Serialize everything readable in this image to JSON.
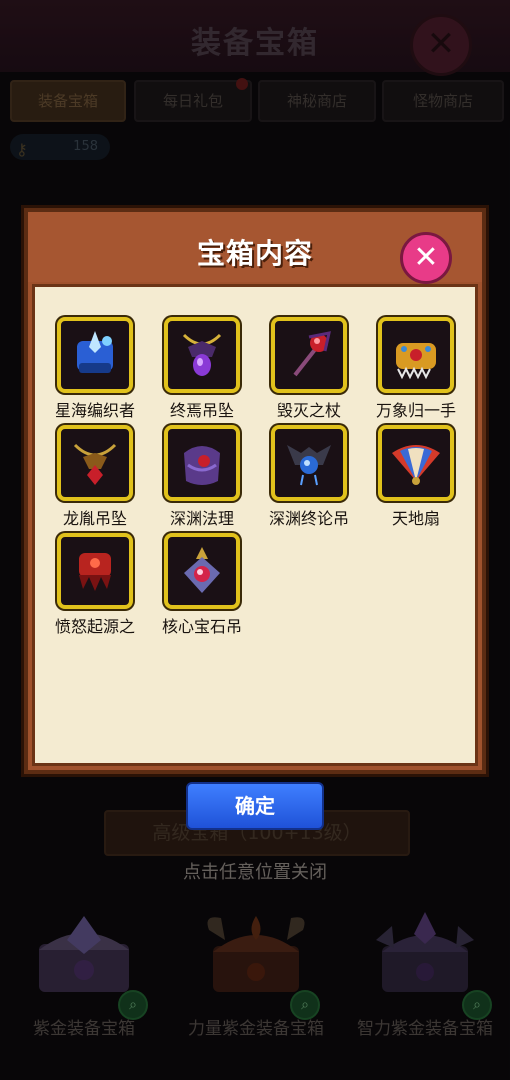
{
  "header": {
    "title": "装备宝箱"
  },
  "tabs": [
    {
      "label": "装备宝箱",
      "active": true
    },
    {
      "label": "每日礼包",
      "active": false
    },
    {
      "label": "神秘商店",
      "active": false
    },
    {
      "label": "怪物商店",
      "active": false
    }
  ],
  "key_count": "158",
  "level_bar": "高级宝箱（100+13级）",
  "hint": "点击任意位置关闭",
  "chests": [
    {
      "label": "紫金装备宝箱",
      "icon": "purple-gold-chest-icon"
    },
    {
      "label": "力量紫金装备宝箱",
      "icon": "strength-chest-icon"
    },
    {
      "label": "智力紫金装备宝箱",
      "icon": "intellect-chest-icon"
    }
  ],
  "modal": {
    "title": "宝箱内容",
    "confirm_label": "确定",
    "items": [
      {
        "name": "星海编织者",
        "icon": "gauntlet-blue-icon"
      },
      {
        "name": "终焉吊坠",
        "icon": "pendant-purple-icon"
      },
      {
        "name": "毁灭之杖",
        "icon": "staff-red-icon"
      },
      {
        "name": "万象归一手",
        "icon": "gauntlet-gold-icon"
      },
      {
        "name": "龙胤吊坠",
        "icon": "necklace-red-icon"
      },
      {
        "name": "深渊法理",
        "icon": "armor-purple-icon"
      },
      {
        "name": "深渊终论吊",
        "icon": "necklace-blue-icon"
      },
      {
        "name": "天地扇",
        "icon": "fan-icon"
      },
      {
        "name": "愤怒起源之",
        "icon": "gauntlet-red-icon"
      },
      {
        "name": "核心宝石吊",
        "icon": "gem-pendant-icon"
      }
    ]
  },
  "colors": {
    "modal_frame": "#a0522d",
    "modal_body": "#f4ebd1",
    "item_border": "#e1c21c",
    "close_pink": "#e83b88",
    "confirm_blue": "#2f6cf0"
  }
}
